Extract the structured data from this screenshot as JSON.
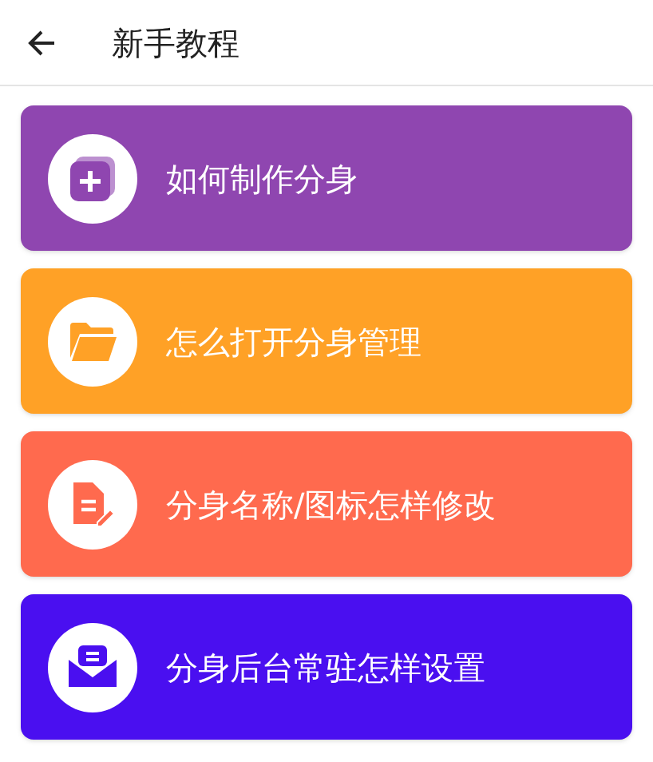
{
  "header": {
    "title": "新手教程"
  },
  "cards": [
    {
      "kind": "add",
      "label": "如何制作分身",
      "color": "#8f46b0"
    },
    {
      "kind": "folder",
      "label": "怎么打开分身管理",
      "color": "#ffa126"
    },
    {
      "kind": "document",
      "label": "分身名称/图标怎样修改",
      "color": "#ff6a4e"
    },
    {
      "kind": "mail",
      "label": "分身后台常驻怎样设置",
      "color": "#4a0ff0"
    }
  ]
}
